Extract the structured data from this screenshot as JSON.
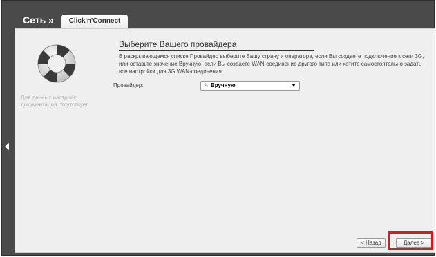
{
  "header": {
    "title": "Сеть »",
    "tab_label": "Click'n'Connect"
  },
  "sidebar": {
    "note": "Для данных настроек документация отсутствует"
  },
  "main": {
    "title": "Выберите Вашего провайдера",
    "description": "В раскрывающемся списке Провайдер выберите Вашу страну и оператора, если Вы создаете подключение к сети 3G, или оставьте значение Вручную, если Вы создаете WAN-соединение другого типа или хотите самостоятельно задать все настройки для 3G WAN-соединения.",
    "provider_label": "Провайдер:",
    "provider_value": "Вручную"
  },
  "buttons": {
    "back": "< Назад",
    "next": "Далее >"
  },
  "colors": {
    "frame": "#4a4a4a",
    "panel": "#efefef",
    "highlight": "#e1161d"
  },
  "icons": [
    "lifebuoy-icon",
    "pencil-icon",
    "dropdown-arrow-icon",
    "left-arrow-icon"
  ]
}
